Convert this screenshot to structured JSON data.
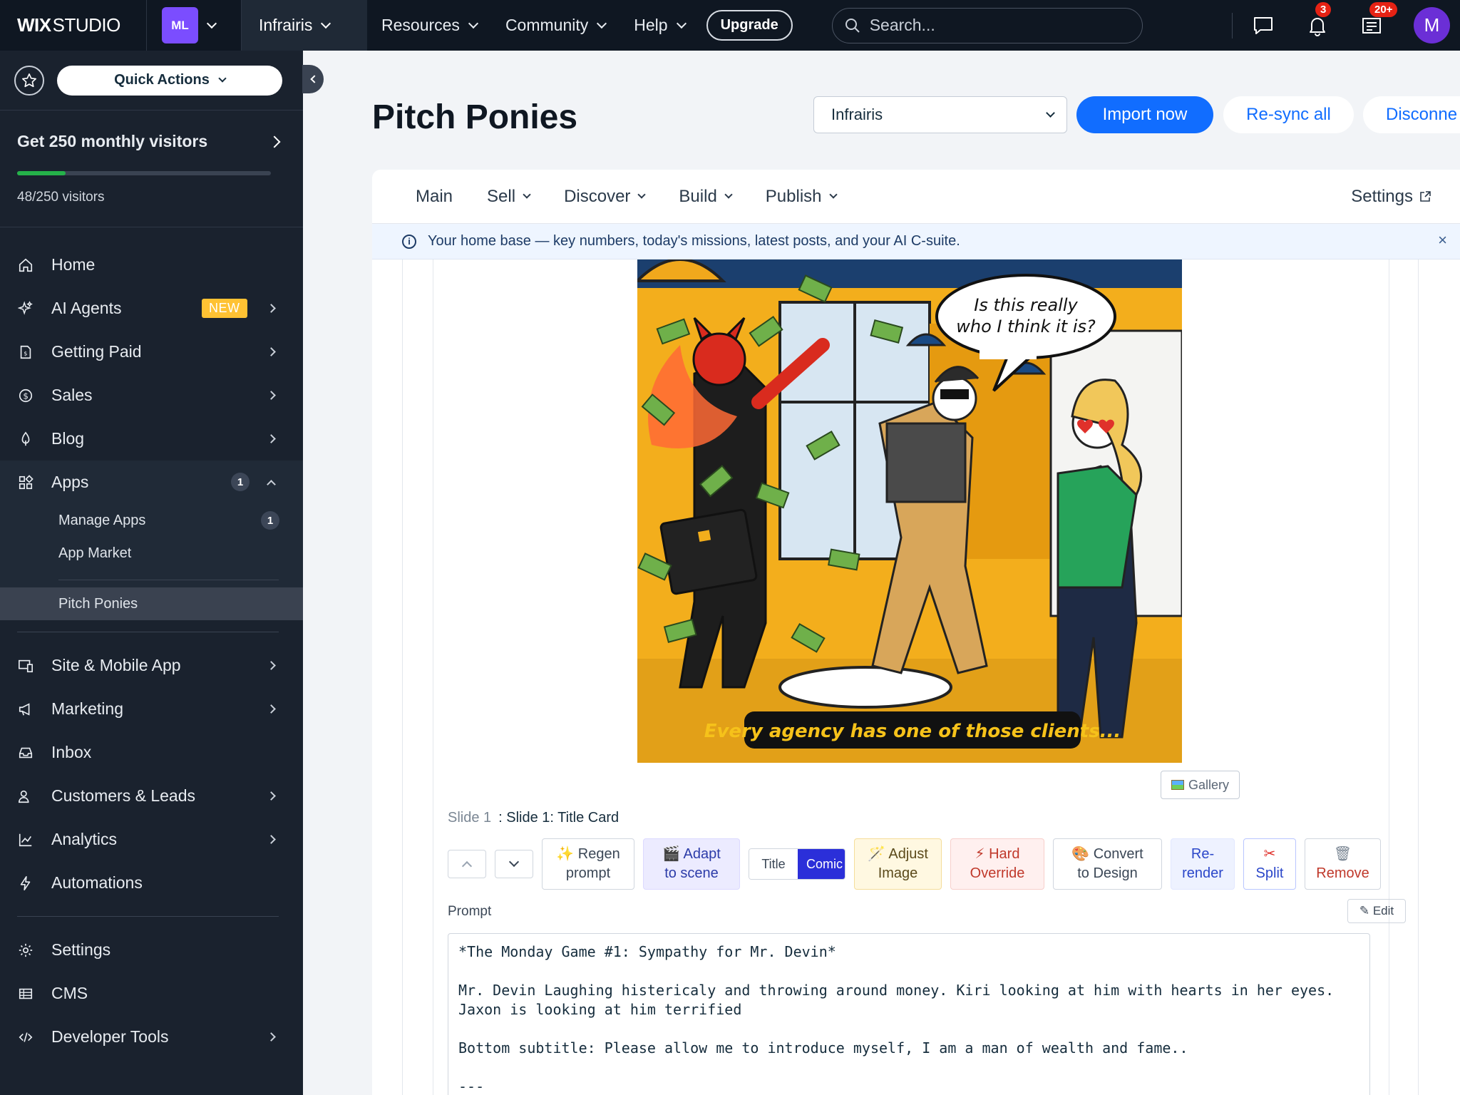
{
  "topbar": {
    "logo_bold": "WIX",
    "logo_thin": "STUDIO",
    "account_initials": "ML",
    "site_name": "Infrairis",
    "nav": [
      "Resources",
      "Community",
      "Help"
    ],
    "upgrade": "Upgrade",
    "search_placeholder": "Search...",
    "notifications_badge": "3",
    "updates_badge": "20+",
    "avatar_initial": "M"
  },
  "sidebar": {
    "quick_actions": "Quick Actions",
    "visitors_title": "Get 250 monthly visitors",
    "visitors_count": "48/250 visitors",
    "visitors_progress": 0.192,
    "items": [
      {
        "label": "Home"
      },
      {
        "label": "AI Agents",
        "badge": "NEW"
      },
      {
        "label": "Getting Paid"
      },
      {
        "label": "Sales"
      },
      {
        "label": "Blog"
      },
      {
        "label": "Apps",
        "count": "1"
      }
    ],
    "apps_sub": [
      {
        "label": "Manage Apps",
        "count": "1"
      },
      {
        "label": "App Market"
      }
    ],
    "active_app": "Pitch Ponies",
    "items2": [
      {
        "label": "Site & Mobile App"
      },
      {
        "label": "Marketing"
      },
      {
        "label": "Inbox"
      },
      {
        "label": "Customers & Leads"
      },
      {
        "label": "Analytics"
      },
      {
        "label": "Automations"
      }
    ],
    "items3": [
      {
        "label": "Settings"
      },
      {
        "label": "CMS"
      },
      {
        "label": "Developer Tools"
      }
    ]
  },
  "main": {
    "title": "Pitch Ponies",
    "site_select": "Infrairis",
    "import_now": "Import now",
    "resync_all": "Re-sync all",
    "disconnect": "Disconne",
    "tabs": [
      "Main",
      "Sell",
      "Discover",
      "Build",
      "Publish"
    ],
    "settings": "Settings",
    "info": "Your home base — key numbers, today's missions, latest posts, and your AI C-suite.",
    "info_close": "×",
    "comic": {
      "speech": [
        "Is this really",
        "who I think it is?"
      ],
      "caption": "Every agency has one of those clients..."
    },
    "gallery": "Gallery",
    "slide_num": "Slide 1",
    "slide_title": ": Slide 1: Title Card",
    "toolbar": {
      "regen": [
        "✨ Regen",
        "prompt"
      ],
      "adapt": [
        "🎬 Adapt",
        "to scene"
      ],
      "title_opt": "Title",
      "comic_opt": "Comic",
      "adjust": [
        "🪄 Adjust",
        "Image"
      ],
      "hard": [
        "⚡ Hard",
        "Override"
      ],
      "convert": [
        "🎨 Convert",
        "to Design"
      ],
      "rerender": [
        "Re-",
        "render"
      ],
      "split": [
        "✂",
        "Split"
      ],
      "remove": [
        "🗑",
        "Remove"
      ]
    },
    "prompt_label": "Prompt",
    "edit": "✎ Edit",
    "prompt_text": "*The Monday Game #1: Sympathy for Mr. Devin*\n\nMr. Devin Laughing histericaly and throwing around money. Kiri looking at him with hearts in her eyes.\nJaxon is looking at him terrified\n\nBottom subtitle: Please allow me to introduce myself, I am a man of wealth and fame..\n\n---"
  },
  "colors": {
    "topbar_bg": "#0f1722",
    "sidebar_bg": "#1a222e",
    "primary": "#116dff",
    "new_badge": "#ffc233",
    "progress": "#25b24a"
  }
}
